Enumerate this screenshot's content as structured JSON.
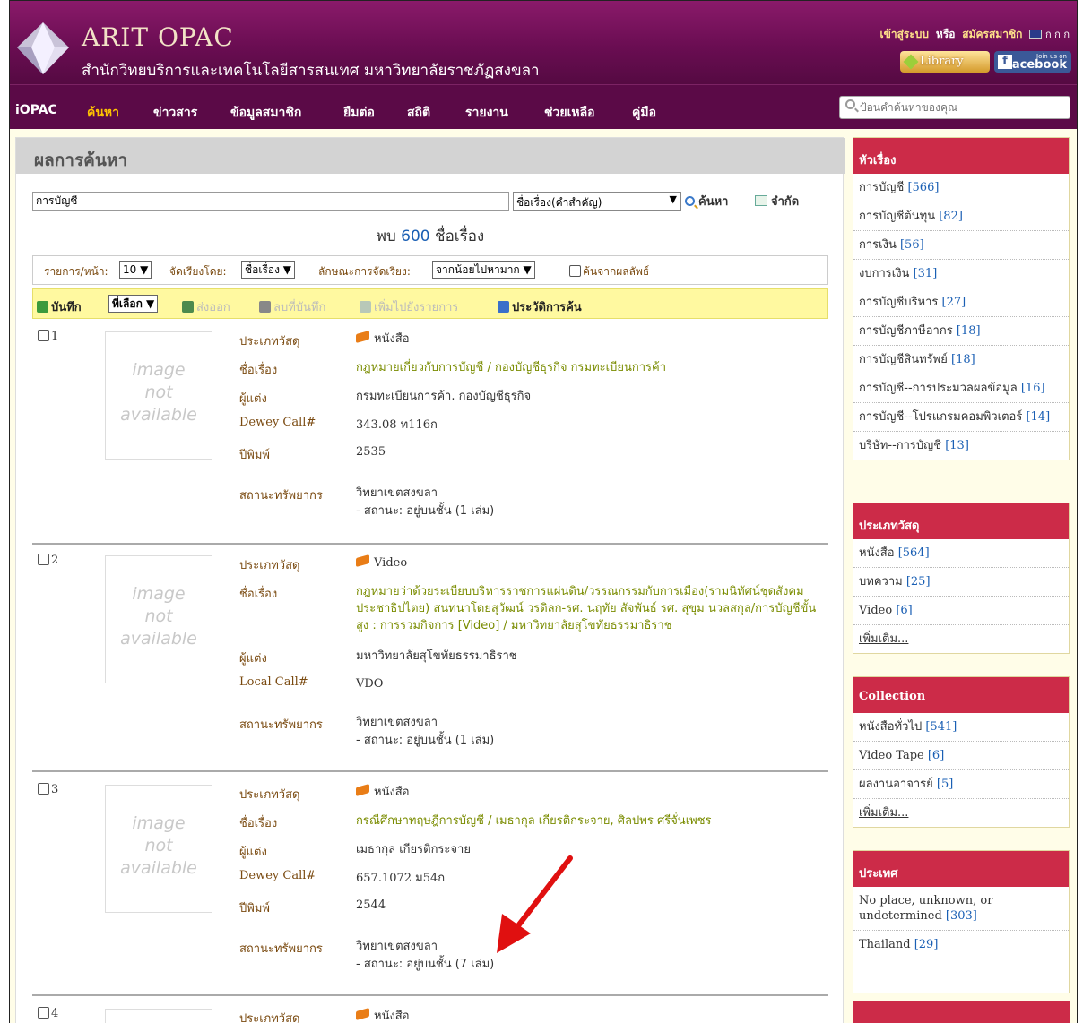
{
  "header": {
    "brand": "ARIT OPAC",
    "subtitle": "สำนักวิทยบริการและเทคโนโลยีสารสนเทศ มหาวิทยาลัยราชภัฏสงขลา",
    "login_link": "เข้าสู่ระบบ",
    "or_text": "หรือ",
    "register_link": "สมัครสมาชิก",
    "font_sizes": "ก ก ก",
    "library_button": "Library",
    "facebook_join": "Join us on",
    "facebook_button": "facebook"
  },
  "nav": {
    "items": [
      "iOPAC",
      "ค้นหา",
      "ข่าวสาร",
      "ข้อมูลสมาชิก",
      "ยืมต่อ",
      "สถิติ",
      "รายงาน",
      "ช่วยเหลือ",
      "คู่มือ"
    ],
    "active": "ค้นหา",
    "search_placeholder": "ป้อนคำค้นหาของคุณ"
  },
  "main": {
    "title": "ผลการค้นหา",
    "query": "การบัญชี",
    "search_field": "ชื่อเรื่อง(คำสำคัญ)",
    "search_button": "ค้นหา",
    "limit_button": "จำกัด",
    "found_prefix": "พบ",
    "found_count": "600",
    "found_suffix": "ชื่อเรื่อง",
    "per_page_label": "รายการ/หน้า:",
    "per_page_value": "10",
    "sort_by_label": "จัดเรียงโดย:",
    "sort_by_value": "ชื่อเรื่อง",
    "sort_order_label": "ลักษณะการจัดเรียง:",
    "sort_order_value": "จากน้อยไปหามาก",
    "search_within": "ค้นจากผลลัพธ์"
  },
  "toolbar": {
    "save": "บันทึก",
    "select": "ที่เลือก",
    "export": "ส่งออก",
    "delete_saved": "ลบที่บันทึก",
    "add_to_list": "เพิ่มไปยังรายการ",
    "history": "ประวัติการค้น"
  },
  "image_placeholder": [
    "image",
    "not",
    "available"
  ],
  "labels": {
    "type": "ประเภทวัสดุ",
    "title": "ชื่อเรื่อง",
    "author": "ผู้แต่ง",
    "dewey": "Dewey Call#",
    "local": "Local Call#",
    "year": "ปีพิมพ์",
    "location": "สถานะทรัพยากร"
  },
  "records": [
    {
      "num": "1",
      "type": "หนังสือ",
      "title": "กฎหมายเกี่ยวกับการบัญชี / กองบัญชีธุรกิจ กรมทะเบียนการค้า",
      "author": "กรมทะเบียนการค้า. กองบัญชีธุรกิจ",
      "call": "343.08 ท116ก",
      "year": "2535",
      "location": "วิทยาเขตสงขลา",
      "status": "- สถานะ: อยู่บนชั้น (1 เล่ม)"
    },
    {
      "num": "2",
      "type": "Video",
      "title": "กฎหมายว่าด้วยระเบียบบริหารราชการแผ่นดิน/วรรณกรรมกับการเมือง(รามนิทัศน์ชุดสังคมประชาธิปไตย) สนทนาโดยสุวัฒน์ วรดิลก-รศ. นฤทัย สัจพันธ์ รศ. สุขุม นวลสกุล/การบัญชีขั้นสูง : การรวมกิจการ [Video] / มหาวิทยาลัยสุโขทัยธรรมาธิราช",
      "author": "มหาวิทยาลัยสุโขทัยธรรมาธิราช",
      "call": "VDO",
      "location": "วิทยาเขตสงขลา",
      "status": "- สถานะ: อยู่บนชั้น (1 เล่ม)"
    },
    {
      "num": "3",
      "type": "หนังสือ",
      "title": "กรณีศึกษาทฤษฎีการบัญชี / เมธากุล เกียรติกระจาย, ศิลปพร ศรีจั่นเพชร",
      "author": "เมธากุล เกียรติกระจาย",
      "call": "657.1072 ม54ก",
      "year": "2544",
      "location": "วิทยาเขตสงขลา",
      "status": "- สถานะ: อยู่บนชั้น (7 เล่ม)"
    },
    {
      "num": "4",
      "type": "หนังสือ"
    }
  ],
  "sidebar": {
    "subject": {
      "title": "หัวเรื่อง",
      "items": [
        {
          "label": "การบัญชี",
          "count": "[566]"
        },
        {
          "label": "การบัญชีต้นทุน",
          "count": "[82]"
        },
        {
          "label": "การเงิน",
          "count": "[56]"
        },
        {
          "label": "งบการเงิน",
          "count": "[31]"
        },
        {
          "label": "การบัญชีบริหาร",
          "count": "[27]"
        },
        {
          "label": "การบัญชีภาษีอากร",
          "count": "[18]"
        },
        {
          "label": "การบัญชีสินทรัพย์",
          "count": "[18]"
        },
        {
          "label": "การบัญชี--การประมวลผลข้อมูล",
          "count": "[16]"
        },
        {
          "label": "การบัญชี--โปรแกรมคอมพิวเตอร์",
          "count": "[14]"
        },
        {
          "label": "บริษัท--การบัญชี",
          "count": "[13]"
        }
      ]
    },
    "material": {
      "title": "ประเภทวัสดุ",
      "items": [
        {
          "label": "หนังสือ",
          "count": "[564]"
        },
        {
          "label": "บทความ",
          "count": "[25]"
        },
        {
          "label": "Video",
          "count": "[6]"
        }
      ],
      "more": "เพิ่มเติม..."
    },
    "collection": {
      "title": "Collection",
      "items": [
        {
          "label": "หนังสือทั่วไป",
          "count": "[541]"
        },
        {
          "label": "Video Tape",
          "count": "[6]"
        },
        {
          "label": "ผลงานอาจารย์",
          "count": "[5]"
        }
      ],
      "more": "เพิ่มเติม..."
    },
    "country": {
      "title": "ประเทศ",
      "items": [
        {
          "label": "No place, unknown, or undetermined",
          "count": "[303]"
        },
        {
          "label": "Thailand",
          "count": "[29]"
        }
      ]
    }
  },
  "colors": {
    "header": "#6a0d52",
    "nav": "#5b0a47",
    "active_nav": "#ffc400",
    "side_header": "#cc2b48",
    "title_link": "#7a8c00",
    "arrow": "#e01010"
  }
}
